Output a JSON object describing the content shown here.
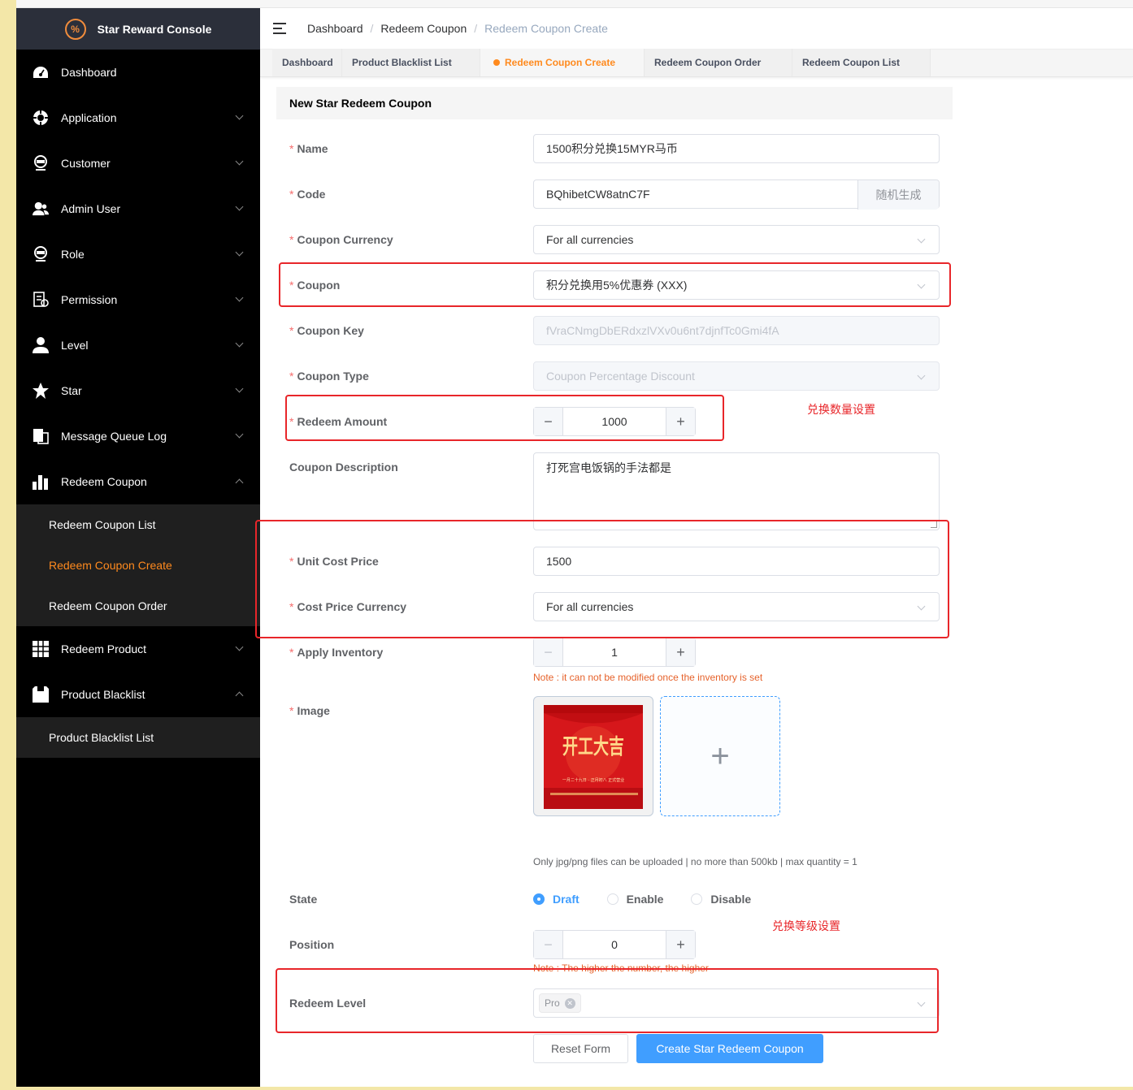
{
  "app": {
    "title": "Star Reward Console",
    "logo_glyph": "%"
  },
  "sidebar": {
    "items": [
      {
        "label": "Dashboard",
        "icon": "dashboard-icon",
        "arrow": ""
      },
      {
        "label": "Application",
        "icon": "application-icon",
        "arrow": "down"
      },
      {
        "label": "Customer",
        "icon": "customer-icon",
        "arrow": "down"
      },
      {
        "label": "Admin User",
        "icon": "admin-user-icon",
        "arrow": "down"
      },
      {
        "label": "Role",
        "icon": "role-icon",
        "arrow": "down"
      },
      {
        "label": "Permission",
        "icon": "permission-icon",
        "arrow": "down"
      },
      {
        "label": "Level",
        "icon": "level-icon",
        "arrow": "down"
      },
      {
        "label": "Star",
        "icon": "star-icon",
        "arrow": "down"
      },
      {
        "label": "Message Queue Log",
        "icon": "message-queue-icon",
        "arrow": "down"
      },
      {
        "label": "Redeem Coupon",
        "icon": "redeem-coupon-icon",
        "arrow": "up"
      }
    ],
    "redeem_coupon_sub": [
      "Redeem Coupon List",
      "Redeem Coupon Create",
      "Redeem Coupon Order"
    ],
    "items2": [
      {
        "label": "Redeem Product",
        "icon": "redeem-product-icon",
        "arrow": "down"
      },
      {
        "label": "Product Blacklist",
        "icon": "product-blacklist-icon",
        "arrow": "up"
      }
    ],
    "product_blacklist_sub": [
      "Product Blacklist List"
    ]
  },
  "breadcrumb": [
    "Dashboard",
    "Redeem Coupon",
    "Redeem Coupon Create"
  ],
  "tabs": [
    "Dashboard",
    "Product Blacklist List",
    "Redeem Coupon Create",
    "Redeem Coupon Order",
    "Redeem Coupon List"
  ],
  "form": {
    "title": "New Star Redeem Coupon",
    "name": {
      "label": "Name",
      "value": "1500积分兑换15MYR马币"
    },
    "code": {
      "label": "Code",
      "value": "BQhibetCW8atnC7F",
      "append": "随机生成"
    },
    "coupon_currency": {
      "label": "Coupon Currency",
      "value": "For all currencies"
    },
    "coupon": {
      "label": "Coupon",
      "value": "积分兑换用5%优惠券 (XXX)"
    },
    "coupon_key": {
      "label": "Coupon Key",
      "value": "fVraCNmgDbERdxzlVXv0u6nt7djnfTc0Gmi4fA"
    },
    "coupon_type": {
      "label": "Coupon Type",
      "value": "Coupon Percentage Discount"
    },
    "redeem_amount": {
      "label": "Redeem Amount",
      "value": "1000"
    },
    "coupon_description": {
      "label": "Coupon Description",
      "value": "打死宫电饭锅的手法都是"
    },
    "unit_cost_price": {
      "label": "Unit Cost Price",
      "value": "1500"
    },
    "cost_price_currency": {
      "label": "Cost Price Currency",
      "value": "For all currencies"
    },
    "apply_inventory": {
      "label": "Apply Inventory",
      "value": "1",
      "note": "Note : it can not be modified once the inventory is set"
    },
    "image": {
      "label": "Image",
      "hint": "Only jpg/png files can be uploaded | no more than 500kb | max quantity = 1",
      "poster_title": "开工大吉",
      "poster_sub": "一月二十九日 · 正月初八\n正式营业"
    },
    "state": {
      "label": "State",
      "options": [
        "Draft",
        "Enable",
        "Disable"
      ],
      "selected": "Draft"
    },
    "position": {
      "label": "Position",
      "value": "0",
      "note": "Note : The higher the number, the higher"
    },
    "redeem_level": {
      "label": "Redeem Level",
      "tags": [
        "Pro"
      ]
    },
    "reset_label": "Reset Form",
    "submit_label": "Create Star Redeem Coupon"
  },
  "annotations": {
    "redeem_amount": "兑换数量设置",
    "redeem_level": "兑换等级设置"
  },
  "colors": {
    "accent": "#409eff",
    "brand_orange": "#ff8a1e",
    "annotation_red": "#e8262a",
    "sidebar_bg": "#000000"
  }
}
